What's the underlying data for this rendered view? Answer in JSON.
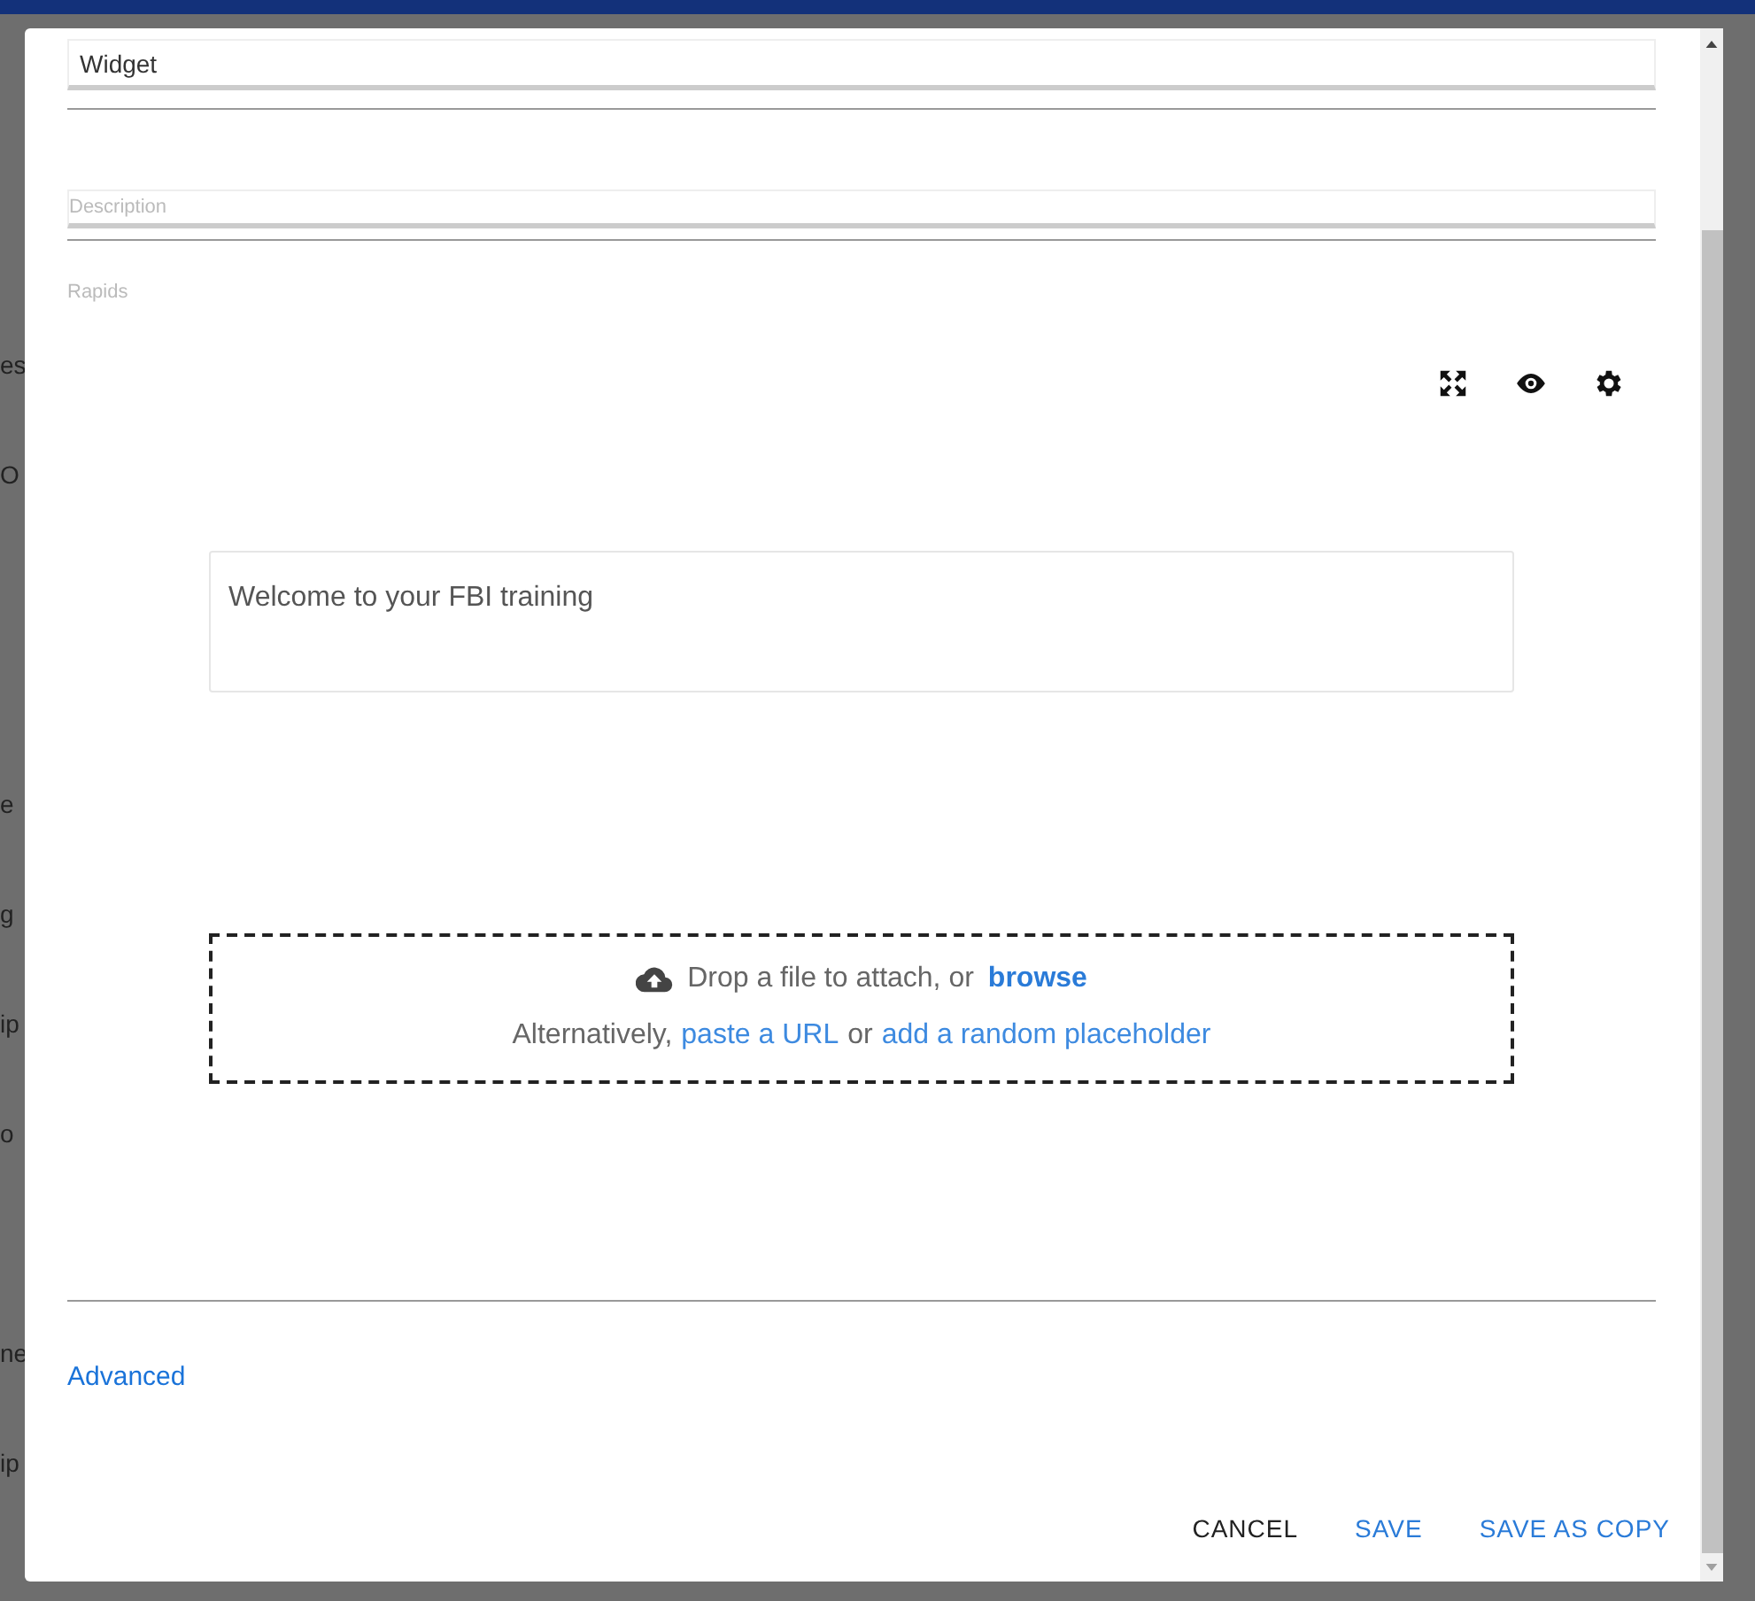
{
  "background_fragments": [
    "es",
    "O",
    "e",
    "g",
    "ip",
    "o",
    "ne",
    "ip"
  ],
  "dialog": {
    "name_field": {
      "value": "Widget"
    },
    "description_field": {
      "placeholder": "Description"
    },
    "rapids_label": "Rapids",
    "editor": {
      "text": "Welcome to your FBI training"
    },
    "dropzone": {
      "line1_text": "Drop a file to attach, or",
      "browse_link": "browse",
      "line2_text": "Alternatively,",
      "url_link": "paste a URL",
      "or_text": "or",
      "placeholder_link": "add a random placeholder"
    },
    "advanced_link": "Advanced",
    "buttons": [
      {
        "label": "CANCEL",
        "kind": "neutral"
      },
      {
        "label": "SAVE",
        "kind": "primary"
      },
      {
        "label": "SAVE AS COPY",
        "kind": "primary"
      }
    ]
  }
}
